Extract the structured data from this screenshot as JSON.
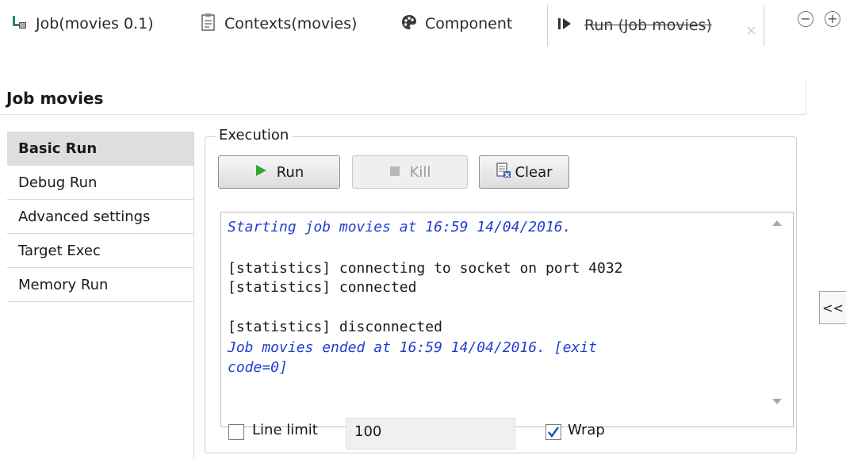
{
  "tabs": {
    "job": "Job(movies 0.1)",
    "contexts": "Contexts(movies)",
    "component": "Component",
    "run": "Run (Job movies)",
    "close": "×",
    "minimize": "−",
    "maximize": "+"
  },
  "job": {
    "title": "Job movies"
  },
  "nav": {
    "items": [
      {
        "label": "Basic Run",
        "active": true
      },
      {
        "label": "Debug Run",
        "active": false
      },
      {
        "label": "Advanced settings",
        "active": false
      },
      {
        "label": "Target Exec",
        "active": false
      },
      {
        "label": "Memory Run",
        "active": false
      }
    ]
  },
  "execution": {
    "legend": "Execution",
    "run_label": "Run",
    "kill_label": "Kill",
    "clear_label": "Clear"
  },
  "console": {
    "lines": [
      {
        "text": "Starting job movies at 16:59 14/04/2016.",
        "style": "blue"
      },
      {
        "text": "[statistics] connecting to socket on port 4032",
        "style": "normal"
      },
      {
        "text": "[statistics] connected",
        "style": "normal"
      },
      {
        "text": "[statistics] disconnected",
        "style": "normal"
      },
      {
        "text": "Job movies ended at 16:59 14/04/2016. [exit",
        "style": "blue"
      },
      {
        "text": "code=0]",
        "style": "blue"
      }
    ]
  },
  "options": {
    "line_limit_label": "Line limit",
    "line_limit_value": "100",
    "line_limit_checked": false,
    "wrap_label": "Wrap",
    "wrap_checked": true
  },
  "side": {
    "collapse_label": "<<"
  },
  "colors": {
    "console_blue": "#1f3fd0",
    "active_nav": "#dedede",
    "run_icon_green": "#2fa82f",
    "checkbox_blue": "#1f4fb5"
  }
}
